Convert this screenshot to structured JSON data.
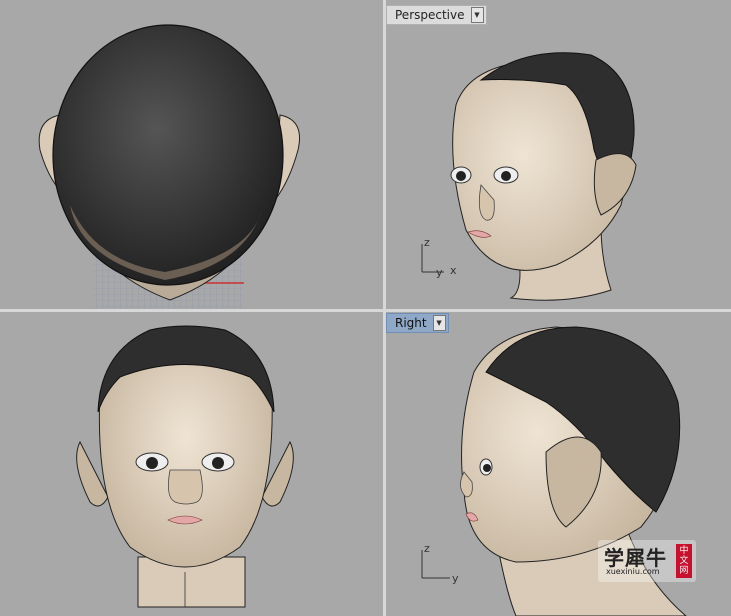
{
  "viewports": {
    "top": {
      "label": ""
    },
    "perspective": {
      "label": "Perspective",
      "axis_z": "z",
      "axis_y": "y",
      "axis_x": "x"
    },
    "front": {
      "label": ""
    },
    "right": {
      "label": "Right",
      "axis_z": "z",
      "axis_y": "y"
    }
  },
  "watermark": {
    "main": "学犀牛",
    "sub": "xuexiniu.com",
    "badge_1": "中",
    "badge_2": "文",
    "badge_3": "网"
  },
  "colors": {
    "viewport_bg": "#a8a8a8",
    "skin": "#d9cbb8",
    "hair": "#3a3a3a",
    "active_tab": "#8fa8c8"
  }
}
